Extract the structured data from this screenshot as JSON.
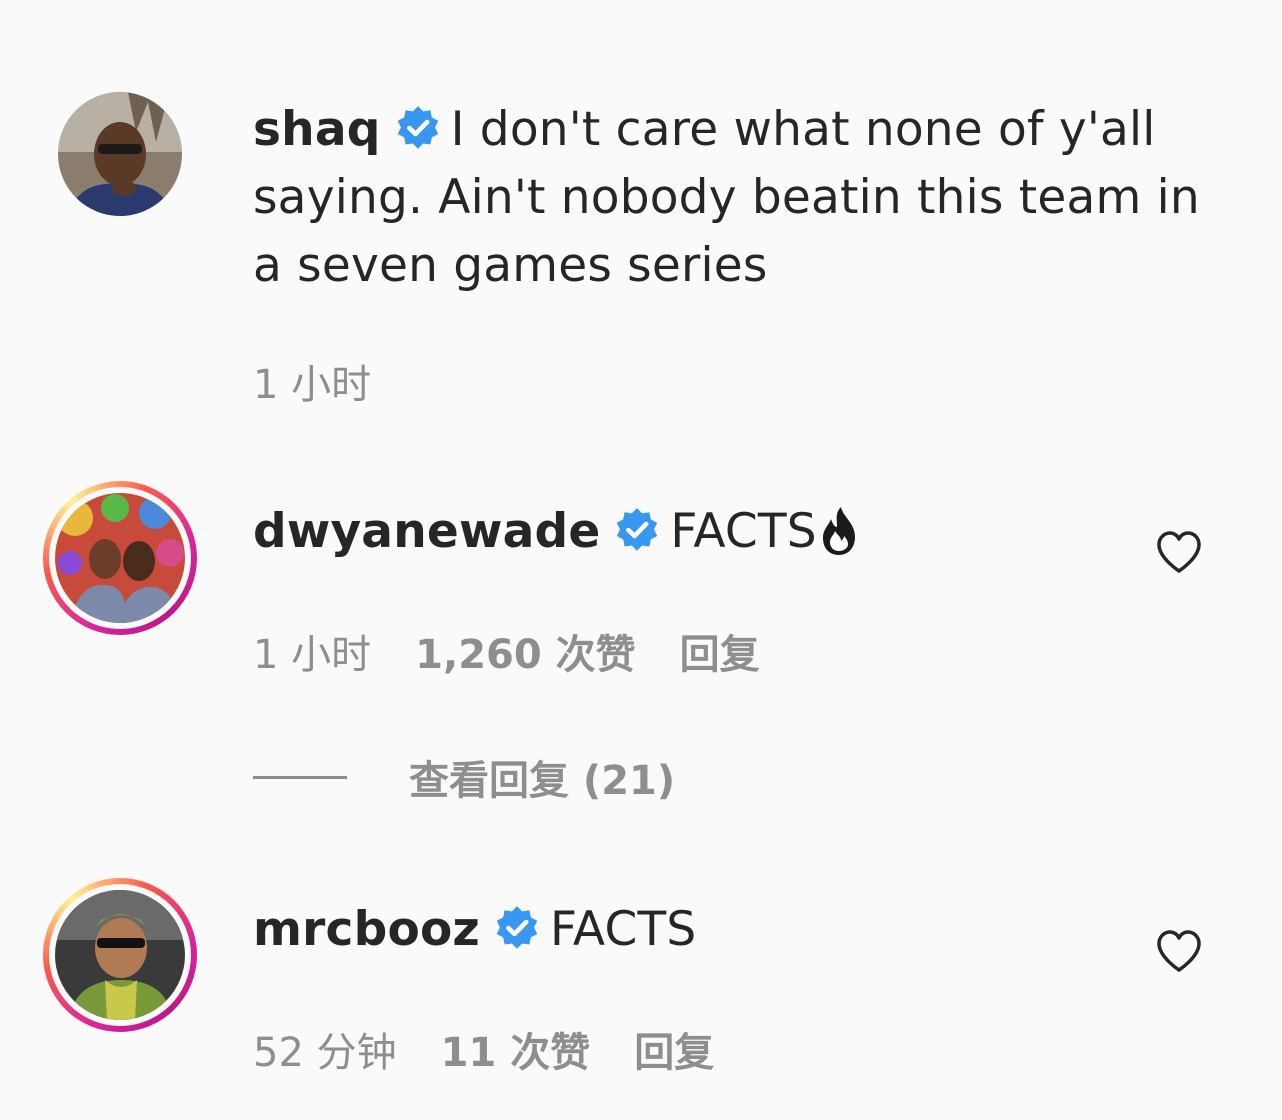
{
  "colors": {
    "background": "#fafafa",
    "text": "#262626",
    "muted": "#8e8e8e",
    "verified": "#3897f0"
  },
  "comments": [
    {
      "username": "shaq",
      "text": "I don't care what none of y'all saying. Ain't nobody beatin this team in a seven games series",
      "time": "1 小时",
      "verified": true,
      "avatar_icon": "avatar-shaq"
    },
    {
      "username": "dwyanewade",
      "text": "FACTS",
      "emoji_icon": "fire-icon",
      "time": "1 小时",
      "likes": "1,260 次赞",
      "reply": "回复",
      "verified": true,
      "avatar_icon": "avatar-dwyanewade",
      "view_replies": "查看回复 (21)"
    },
    {
      "username": "mrcbooz",
      "text": "FACTS",
      "time": "52 分钟",
      "likes": "11 次赞",
      "reply": "回复",
      "verified": true,
      "avatar_icon": "avatar-mrcbooz"
    }
  ]
}
